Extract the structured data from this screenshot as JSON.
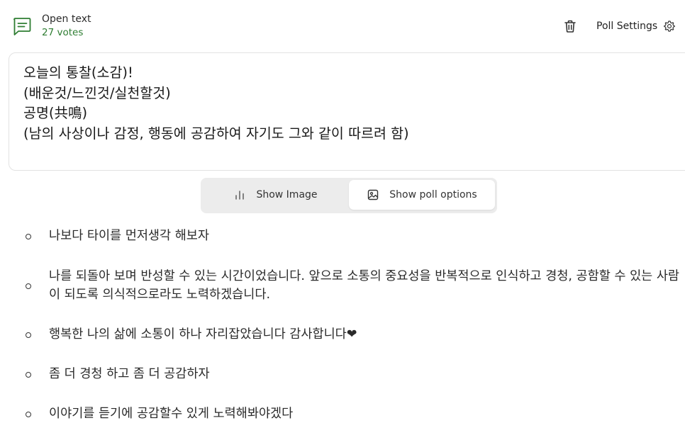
{
  "header": {
    "type_icon": "chat-lines-icon",
    "type_label": "Open text",
    "votes": "27 votes",
    "delete_icon": "trash-icon",
    "settings_label": "Poll Settings",
    "settings_icon": "gear-icon"
  },
  "question": {
    "text": "오늘의 통찰(소감)!\n(배운것/느낀것/실천할것)\n공명(共鳴)\n(남의 사상이나 감정, 행동에 공감하여 자기도 그와 같이 따르려 함)"
  },
  "view_toggle": {
    "left_label": "Show Image",
    "left_icon": "bar-chart-icon",
    "right_label": "Show poll options",
    "right_icon": "image-icon",
    "active": "right"
  },
  "answers": [
    {
      "text": "나보다 타이를 먼저생각 해보자"
    },
    {
      "text": "나를 되돌아 보며 반성할 수 있는 시간이었습니다. 앞으로 소통의 중요성을 반복적으로 인식하고 경청, 공함할 수 있는 사람이 되도록 의식적으로라도 노력하겠습니다."
    },
    {
      "text": "행복한 나의 삶에 소통이 하나 자리잡았습니다 감사합니다❤"
    },
    {
      "text": "좀 더 경청 하고 좀 더 공감하자"
    },
    {
      "text": "이야기를 듣기에 공감할수 있게 노력해봐야겠다"
    }
  ],
  "colors": {
    "votes": "#2e7d32",
    "icon_accent": "#2e7d32",
    "toggle_bg": "#ececec"
  }
}
